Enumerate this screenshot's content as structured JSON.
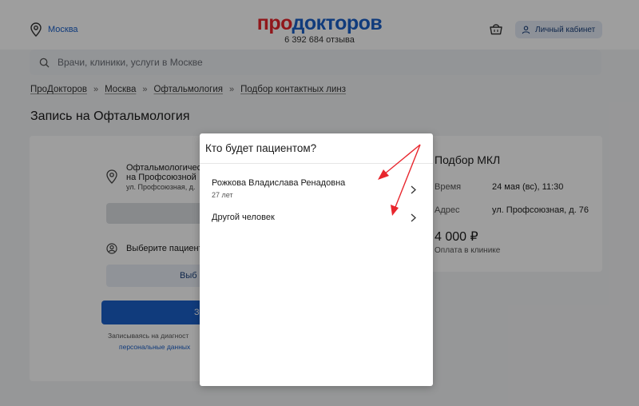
{
  "header": {
    "city": "Москва",
    "logo_pro": "про",
    "logo_doc": "докторов",
    "reviews": "6 392 684 отзыва",
    "cabinet_label": "Личный кабинет"
  },
  "search": {
    "placeholder": "Врачи, клиники, услуги в Москве"
  },
  "breadcrumbs": {
    "items": [
      "ПроДокторов",
      "Москва",
      "Офтальмология",
      "Подбор контактных линз"
    ],
    "separator": "»"
  },
  "page": {
    "title": "Запись на Офтальмология"
  },
  "clinic_card": {
    "name_line1": "Офтальмологичес",
    "name_line2": "на Профсоюзной",
    "address": "ул. Профсоюзная, д.",
    "patient_prompt": "Выберите пациент",
    "choose_button": "Выб",
    "submit_button": "З",
    "note_line1": "Записываясь на диагност",
    "note_line2": "персональные данных"
  },
  "summary_card": {
    "title": "Подбор МКЛ",
    "time_label": "Время",
    "time_value": "24 мая (вс), 11:30",
    "address_label": "Адрес",
    "address_value": "ул. Профсоюзная, д. 76",
    "price": "4 000 ₽",
    "price_note": "Оплата в клинике"
  },
  "modal": {
    "title": "Кто будет пациентом?",
    "options": [
      {
        "name": "Рожкова Владислава Ренадовна",
        "age": "27 лет"
      },
      {
        "name": "Другой человек"
      }
    ]
  },
  "colors": {
    "brand_blue": "#1a5fc8",
    "brand_red": "#e8262d",
    "annotation_arrow": "#e8262d"
  }
}
